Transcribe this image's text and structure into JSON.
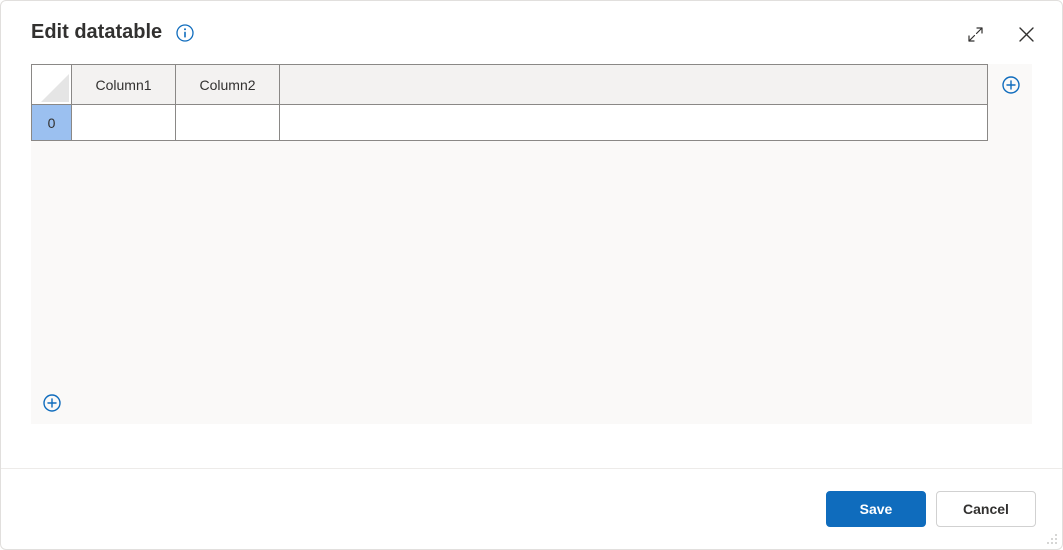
{
  "dialog": {
    "title": "Edit datatable"
  },
  "table": {
    "columns": [
      "Column1",
      "Column2",
      ""
    ],
    "rows": [
      {
        "index": "0",
        "cells": [
          "",
          "",
          ""
        ]
      }
    ]
  },
  "buttons": {
    "save": "Save",
    "cancel": "Cancel"
  },
  "colors": {
    "accent": "#0f6cbd",
    "rowHeaderSelected": "#9bc0f0"
  }
}
